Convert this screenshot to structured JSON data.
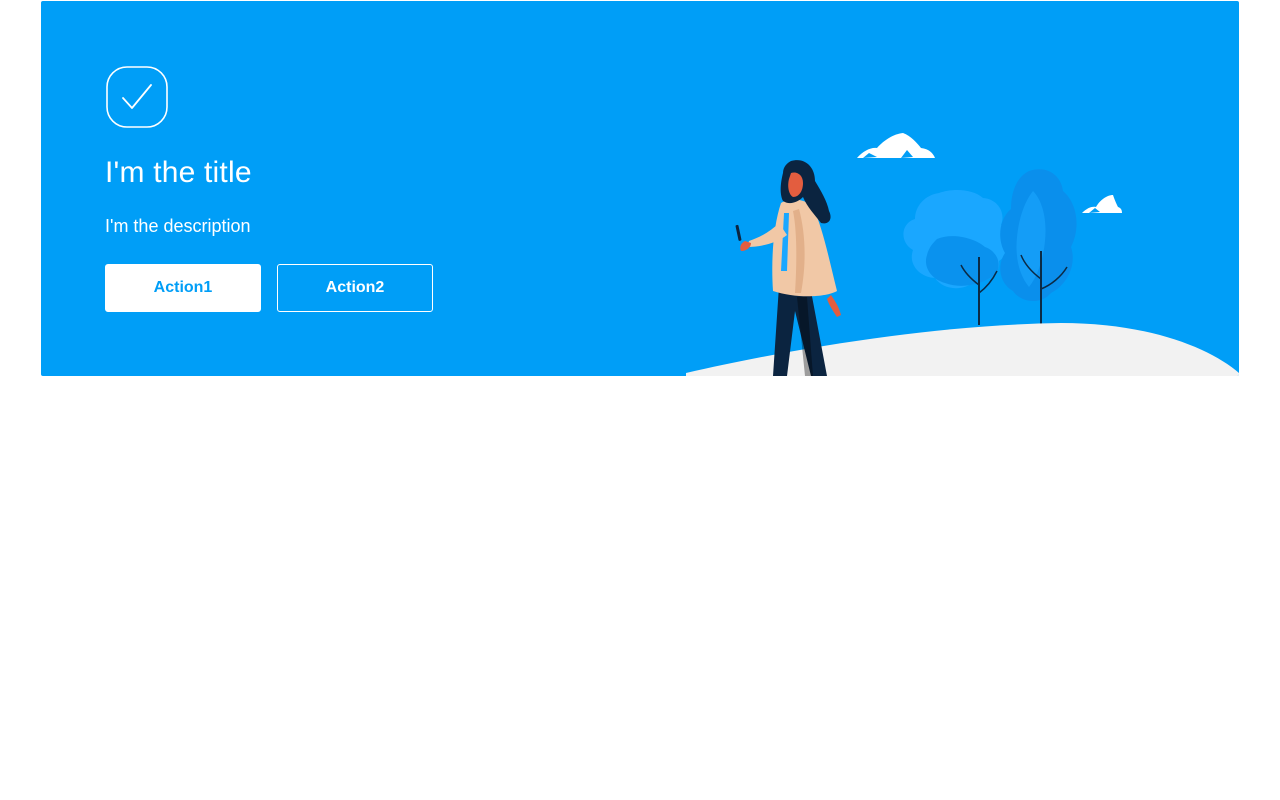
{
  "banner": {
    "icon": "check-circle-icon",
    "title": "I'm the title",
    "description": "I'm the description",
    "actions": [
      {
        "label": "Action1",
        "style": "primary"
      },
      {
        "label": "Action2",
        "style": "outline"
      }
    ],
    "illustration": "woman-walking-with-phone-illustration"
  },
  "colors": {
    "banner_background": "#009ef7",
    "text": "#ffffff",
    "primary_button_text": "#009ef7",
    "ground": "#f2f2f2",
    "tree_light": "#1aa7ff",
    "tree_dark": "#0088e6"
  }
}
